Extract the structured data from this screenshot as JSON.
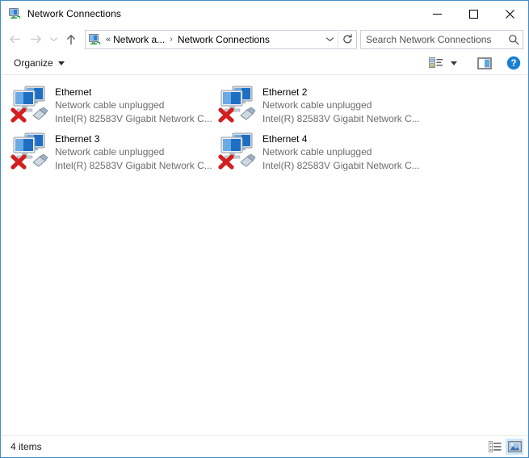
{
  "window": {
    "title": "Network Connections",
    "title_icon": "network-connections-icon",
    "controls": {
      "minimize": "minimize-button",
      "maximize": "maximize-button",
      "close": "close-button"
    }
  },
  "nav": {
    "back": "back-arrow-icon",
    "forward": "forward-arrow-icon",
    "history": "recent-locations-chevron-icon",
    "up": "up-arrow-icon",
    "address_icon": "network-connections-icon",
    "breadcrumb": {
      "overflow": "«",
      "parent": "Network a...",
      "separator": "›",
      "current": "Network Connections"
    },
    "dropdown": "chevron-down-icon",
    "refresh": "refresh-icon"
  },
  "search": {
    "placeholder": "Search Network Connections",
    "value": "",
    "icon": "search-icon"
  },
  "toolbar": {
    "organize_label": "Organize",
    "organize_caret": "chevron-down-icon",
    "view_options_icon": "view-options-icon",
    "view_options_caret": "chevron-down-icon",
    "preview_pane_icon": "preview-pane-icon",
    "help_icon": "help-icon"
  },
  "items": [
    {
      "name": "Ethernet",
      "status": "Network cable unplugged",
      "device": "Intel(R) 82583V Gigabit Network C...",
      "icon": "network-adapter-disconnected-icon"
    },
    {
      "name": "Ethernet 2",
      "status": "Network cable unplugged",
      "device": "Intel(R) 82583V Gigabit Network C...",
      "icon": "network-adapter-disconnected-icon"
    },
    {
      "name": "Ethernet 3",
      "status": "Network cable unplugged",
      "device": "Intel(R) 82583V Gigabit Network C...",
      "icon": "network-adapter-disconnected-icon"
    },
    {
      "name": "Ethernet 4",
      "status": "Network cable unplugged",
      "device": "Intel(R) 82583V Gigabit Network C...",
      "icon": "network-adapter-disconnected-icon"
    }
  ],
  "statusbar": {
    "count_text": "4 items",
    "details_view_icon": "details-view-icon",
    "large_icons_view_icon": "large-icons-view-icon"
  },
  "colors": {
    "window_border": "#3f8cc9",
    "accent_blue": "#0078d7",
    "text_primary": "#000000",
    "text_secondary": "#6d6d6d",
    "selection_blue": "#cce8ff"
  }
}
